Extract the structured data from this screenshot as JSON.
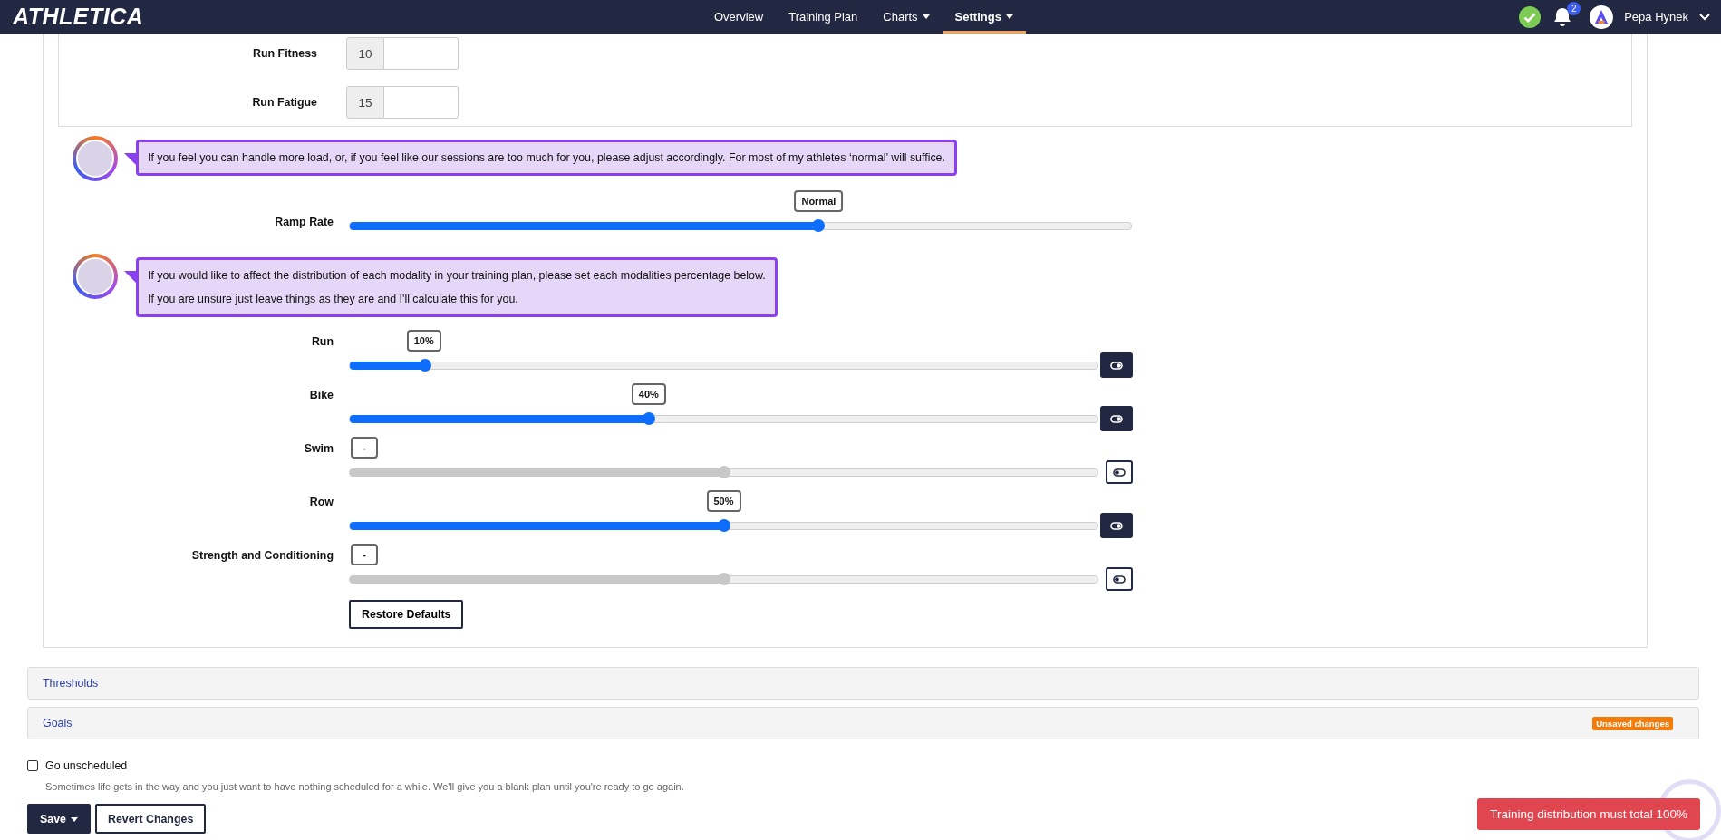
{
  "nav": {
    "logo": "ATHLETICA",
    "items": [
      {
        "label": "Overview",
        "selected": false,
        "dropdown": false
      },
      {
        "label": "Training Plan",
        "selected": false,
        "dropdown": false
      },
      {
        "label": "Charts",
        "selected": false,
        "dropdown": true
      },
      {
        "label": "Settings",
        "selected": true,
        "dropdown": true
      }
    ],
    "notifications": "2",
    "user": "Pepa Hynek"
  },
  "load_fields": [
    {
      "label": "Run Fitness",
      "addon": "10"
    },
    {
      "label": "Run Fatigue",
      "addon": "15"
    }
  ],
  "ramp_intro": [
    "If you feel you can handle more load, or, if you feel like our sessions are too much for you, please adjust accordingly. For most of my athletes ‘normal’ will suffice."
  ],
  "ramp_rate": {
    "label": "Ramp Rate",
    "level": 0.6,
    "reading": "Normal"
  },
  "distribution_intro": [
    "If you would like to affect the distribution of each modality in your training plan, please set each modalities percentage below.",
    "If you are unsure just leave things as they are and I'll calculate this for you."
  ],
  "modalities": [
    {
      "label": "Run",
      "reading": "10%",
      "level": 0.1,
      "enabled": true
    },
    {
      "label": "Bike",
      "reading": "40%",
      "level": 0.4,
      "enabled": true
    },
    {
      "label": "Swim",
      "reading": "-",
      "level": 0.5,
      "enabled": false
    },
    {
      "label": "Row",
      "reading": "50%",
      "level": 0.5,
      "enabled": true
    },
    {
      "label": "Strength and Conditioning",
      "reading": "-",
      "level": 0.5,
      "enabled": false
    }
  ],
  "restore_button": "Restore Defaults",
  "panels": [
    {
      "title": "Thresholds"
    },
    {
      "title": "Goals",
      "badge": "Unsaved changes"
    }
  ],
  "go_unscheduled": {
    "label": "Go unscheduled",
    "checked": false,
    "description": "Sometimes life gets in the way and you just want to have nothing scheduled for a while. We'll give you a blank plan until you're ready to go again."
  },
  "buttons": {
    "save": "Save",
    "revert": "Revert Changes"
  },
  "toast": "Training distribution must total 100%"
}
